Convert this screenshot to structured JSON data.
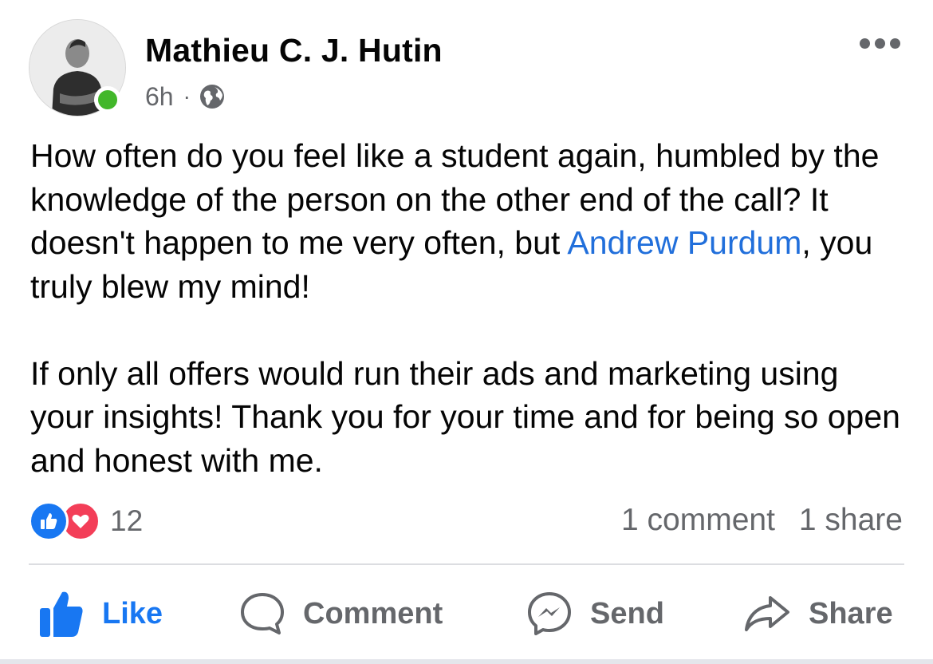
{
  "post": {
    "author": "Mathieu C. J. Hutin",
    "timestamp": "6h",
    "separator": "·",
    "privacy_icon": "globe-icon",
    "online_color": "#42b72a",
    "paragraphs": [
      {
        "before_mention": "How often do you feel like a student again, humbled by the knowledge of the person on the other end of the call? It doesn't happen to me very often, but ",
        "mention": "Andrew Purdum",
        "after_mention": ", you truly blew my mind!"
      },
      {
        "text": "If only all offers would run their ads and marketing using your insights! Thank you for your time and for being so open and honest with me."
      }
    ],
    "mention_color": "#216fdb"
  },
  "stats": {
    "reaction_icons": [
      "like-reaction-icon",
      "love-reaction-icon"
    ],
    "reaction_count": "12",
    "comments": "1 comment",
    "shares": "1 share"
  },
  "actions": {
    "like": "Like",
    "comment": "Comment",
    "send": "Send",
    "share": "Share",
    "accent_color": "#1877f2"
  }
}
